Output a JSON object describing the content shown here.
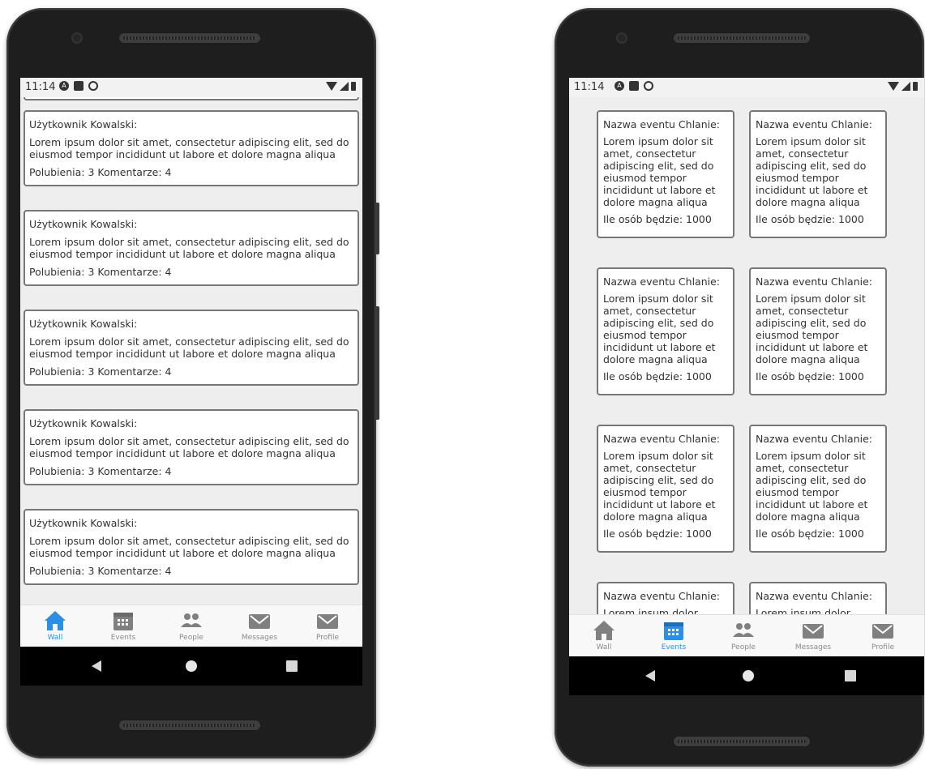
{
  "phones": [
    {
      "status": {
        "time": "11:14"
      },
      "posts": [
        {
          "author": "Użytkownik Kowalski:",
          "body": "Lorem ipsum dolor sit amet, consectetur adipiscing elit, sed do eiusmod tempor incididunt ut labore et dolore magna aliqua",
          "stats": "Polubienia: 3 Komentarze: 4"
        },
        {
          "author": "Użytkownik Kowalski:",
          "body": "Lorem ipsum dolor sit amet, consectetur adipiscing elit, sed do eiusmod tempor incididunt ut labore et dolore magna aliqua",
          "stats": "Polubienia: 3 Komentarze: 4"
        },
        {
          "author": "Użytkownik Kowalski:",
          "body": "Lorem ipsum dolor sit amet, consectetur adipiscing elit, sed do eiusmod tempor incididunt ut labore et dolore magna aliqua",
          "stats": "Polubienia: 3 Komentarze: 4"
        },
        {
          "author": "Użytkownik Kowalski:",
          "body": "Lorem ipsum dolor sit amet, consectetur adipiscing elit, sed do eiusmod tempor incididunt ut labore et dolore magna aliqua",
          "stats": "Polubienia: 3 Komentarze: 4"
        },
        {
          "author": "Użytkownik Kowalski:",
          "body": "Lorem ipsum dolor sit amet, consectetur adipiscing elit, sed do eiusmod tempor incididunt ut labore et dolore magna aliqua",
          "stats": "Polubienia: 3 Komentarze: 4"
        }
      ],
      "tabs": [
        {
          "label": "Wall",
          "icon": "home-icon",
          "active": true
        },
        {
          "label": "Events",
          "icon": "calendar-icon",
          "active": false
        },
        {
          "label": "People",
          "icon": "people-icon",
          "active": false
        },
        {
          "label": "Messages",
          "icon": "envelope-icon",
          "active": false
        },
        {
          "label": "Profile",
          "icon": "envelope-icon",
          "active": false
        }
      ]
    },
    {
      "status": {
        "time": "11:14"
      },
      "events": [
        {
          "title": "Nazwa eventu Chlanie:",
          "body": "Lorem ipsum dolor sit amet, consectetur adipiscing elit, sed do eiusmod tempor incididunt ut labore et dolore magna aliqua",
          "count": "Ile osób będzie: 1000"
        },
        {
          "title": "Nazwa eventu Chlanie:",
          "body": "Lorem ipsum dolor sit amet, consectetur adipiscing elit, sed do eiusmod tempor incididunt ut labore et dolore magna aliqua",
          "count": "Ile osób będzie: 1000"
        },
        {
          "title": "Nazwa eventu Chlanie:",
          "body": "Lorem ipsum dolor sit amet, consectetur adipiscing elit, sed do eiusmod tempor incididunt ut labore et dolore magna aliqua",
          "count": "Ile osób będzie: 1000"
        },
        {
          "title": "Nazwa eventu Chlanie:",
          "body": "Lorem ipsum dolor sit amet, consectetur adipiscing elit, sed do eiusmod tempor incididunt ut labore et dolore magna aliqua",
          "count": "Ile osób będzie: 1000"
        },
        {
          "title": "Nazwa eventu Chlanie:",
          "body": "Lorem ipsum dolor sit amet, consectetur adipiscing elit, sed do eiusmod tempor incididunt ut labore et dolore magna aliqua",
          "count": "Ile osób będzie: 1000"
        },
        {
          "title": "Nazwa eventu Chlanie:",
          "body": "Lorem ipsum dolor sit amet, consectetur adipiscing elit, sed do eiusmod tempor incididunt ut labore et dolore magna aliqua",
          "count": "Ile osób będzie: 1000"
        },
        {
          "title": "Nazwa eventu Chlanie:",
          "body": "Lorem insum dolor",
          "count": ""
        },
        {
          "title": "Nazwa eventu Chlanie:",
          "body": "Lorem insum dolor",
          "count": ""
        }
      ],
      "tabs": [
        {
          "label": "Wall",
          "icon": "home-icon",
          "active": false
        },
        {
          "label": "Events",
          "icon": "calendar-icon",
          "active": true
        },
        {
          "label": "People",
          "icon": "people-icon",
          "active": false
        },
        {
          "label": "Messages",
          "icon": "envelope-icon",
          "active": false
        },
        {
          "label": "Profile",
          "icon": "envelope-icon",
          "active": false
        }
      ]
    }
  ],
  "colors": {
    "active_tab": "#2b8fe8",
    "inactive_icon": "#808080",
    "card_border": "#777777"
  }
}
